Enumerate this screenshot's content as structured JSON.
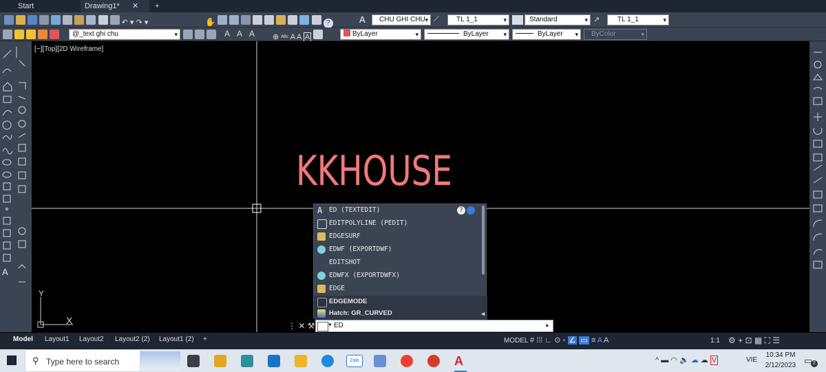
{
  "tabs": {
    "start": "Start",
    "drawing": "Drawing1*",
    "close": "✕",
    "new": "+"
  },
  "ribbon": {
    "text_style": "CHU GHI CHU",
    "dim_style": "TL 1_1",
    "table_style": "Standard",
    "multileader_style": "TL 1_1",
    "layer": "@_text ghi chu",
    "color": "ByLayer",
    "linetype": "ByLayer",
    "lineweight": "ByLayer",
    "plotstyle": "ByColor",
    "text_tools": "A A A"
  },
  "viewport": {
    "label": "[−][Top][2D Wireframe]",
    "y_axis": "Y",
    "x_axis": "X"
  },
  "drawing_text": "KKHOUSE",
  "autocomplete": [
    "ED (TEXTEDIT)",
    "EDITPOLYLINE (PEDIT)",
    "EDGESURF",
    "EDWF (EXPORTDWF)",
    "EDITSHOT",
    "EDWFX (EXPORTDWFX)",
    "EDGE",
    "EDGEMODE",
    "Hatch: GR_CURVED"
  ],
  "command": {
    "value": "ED"
  },
  "layout_tabs": [
    "Model",
    "Layout1",
    "Layout2",
    "Layout2 (2)",
    "Layout1 (2)",
    "+"
  ],
  "status": {
    "model": "MODEL",
    "scale": "1:1"
  },
  "taskbar": {
    "search_placeholder": "Type here to search",
    "lang": "VIE",
    "time": "10:34 PM",
    "date": "2/12/2023",
    "notifications": "2",
    "zalo": "Zalo"
  },
  "colors": {
    "accent": "#f07a78",
    "ribbon_bg": "#3b4453",
    "tab_bg": "#1e2633"
  }
}
